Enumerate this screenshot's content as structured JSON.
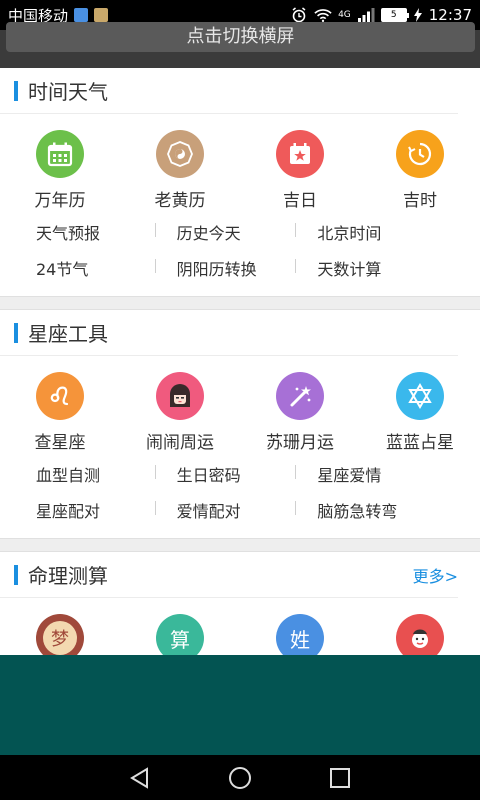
{
  "status_bar": {
    "carrier": "中国移动",
    "network": "4G",
    "battery": "5",
    "time": "12:37"
  },
  "top": {
    "switch_label": "点击切换横屏"
  },
  "sections": [
    {
      "title": "时间天气",
      "icons": [
        {
          "label": "万年历",
          "icon": "calendar-icon",
          "color": "#6cc04a"
        },
        {
          "label": "老黄历",
          "icon": "bagua-icon",
          "color": "#c8a07a"
        },
        {
          "label": "吉日",
          "icon": "star-calendar-icon",
          "color": "#ef5a5a"
        },
        {
          "label": "吉时",
          "icon": "clock-icon",
          "color": "#f7a21b"
        }
      ],
      "links": [
        [
          "天气预报",
          "历史今天",
          "北京时间"
        ],
        [
          "24节气",
          "阴阳历转换",
          "天数计算"
        ]
      ]
    },
    {
      "title": "星座工具",
      "icons": [
        {
          "label": "查星座",
          "icon": "leo-icon",
          "color": "#f5943a"
        },
        {
          "label": "闹闹周运",
          "icon": "girl-avatar-icon",
          "color": "#f05a7e"
        },
        {
          "label": "苏珊月运",
          "icon": "magic-wand-icon",
          "color": "#a770d6"
        },
        {
          "label": "蓝蓝占星",
          "icon": "hexagram-icon",
          "color": "#3ab8ec"
        }
      ],
      "links": [
        [
          "血型自测",
          "生日密码",
          "星座爱情"
        ],
        [
          "星座配对",
          "爱情配对",
          "脑筋急转弯"
        ]
      ]
    },
    {
      "title": "命理测算",
      "more": "更多>",
      "icons": [
        {
          "label": "梦",
          "icon": "dream-icon",
          "color": "#a0493a"
        },
        {
          "label": "算",
          "icon": "calculate-icon",
          "color": "#3ab89a"
        },
        {
          "label": "姓",
          "icon": "surname-icon",
          "color": "#4a90e2"
        },
        {
          "label": "",
          "icon": "fortune-god-icon",
          "color": "#e85050"
        }
      ]
    }
  ],
  "colors": {
    "accent": "#1a8fe0",
    "panel": "#035452"
  }
}
